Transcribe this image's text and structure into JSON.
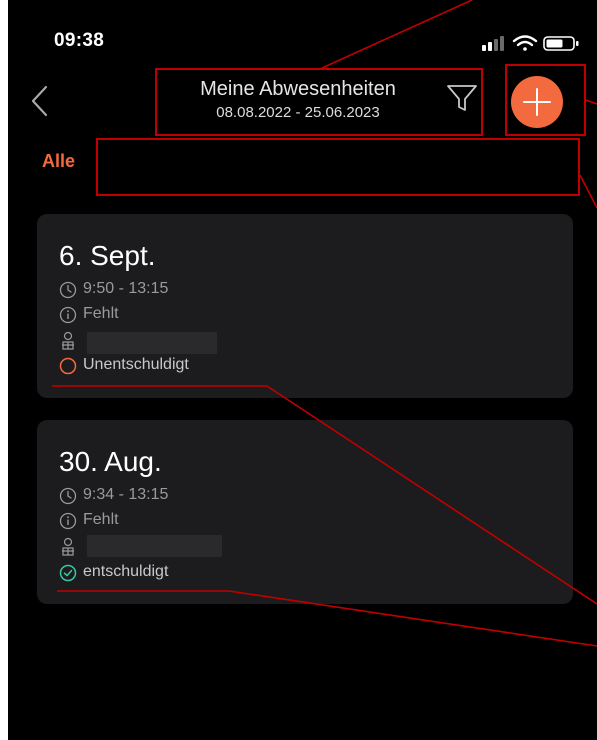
{
  "status_bar": {
    "time": "09:38"
  },
  "header": {
    "title": "Meine Abwesenheiten",
    "date_range": "08.08.2022 - 25.06.2023"
  },
  "tabs": [
    {
      "label": "Alle"
    }
  ],
  "absences": [
    {
      "date": "6. Sept.",
      "time": "9:50 - 13:15",
      "type": "Fehlt",
      "status": "Unentschuldigt",
      "status_color": "#f46a3f",
      "status_icon": "open-circle-icon"
    },
    {
      "date": "30. Aug.",
      "time": "9:34 - 13:15",
      "type": "Fehlt",
      "status": "entschuldigt",
      "status_color": "#3cc6a0",
      "status_icon": "check-circle-icon"
    }
  ],
  "colors": {
    "accent": "#f46a3f",
    "background": "#000000",
    "card": "#1c1c1e",
    "annotation": "#c00000"
  }
}
